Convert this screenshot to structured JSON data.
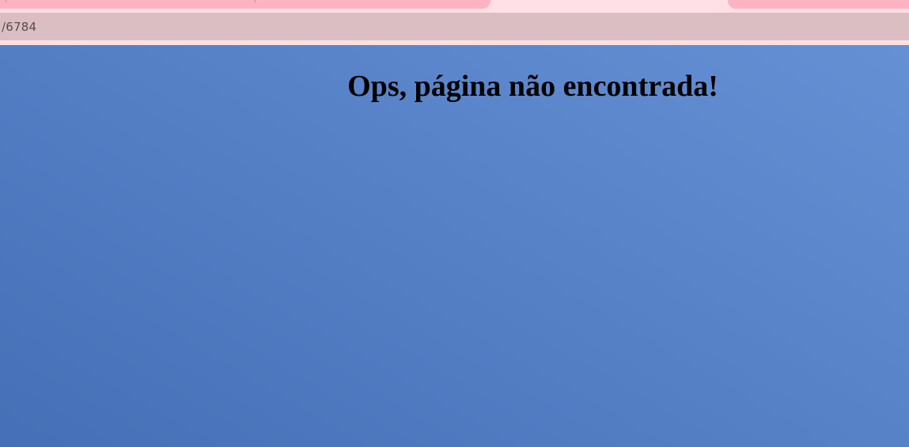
{
  "browser": {
    "address": "/6784"
  },
  "page": {
    "title": "Ops, página não encontrada!"
  },
  "colors": {
    "chrome_background": "#ffe0e6",
    "tab_active": "#ffb3c2",
    "address_bar": "#dbbec2",
    "page_gradient_start": "#4570b7",
    "page_gradient_end": "#6690d4"
  }
}
